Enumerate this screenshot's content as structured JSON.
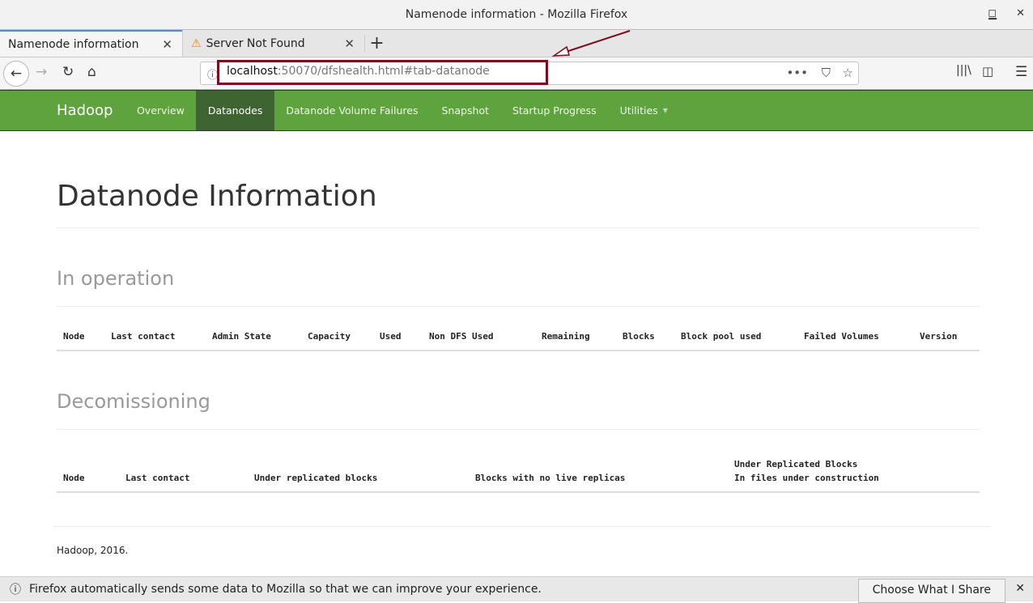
{
  "window": {
    "title": "Namenode information - Mozilla Firefox"
  },
  "tabs": [
    {
      "label": "Namenode information",
      "active": true
    },
    {
      "label": "Server Not Found",
      "icon": "warning-icon"
    }
  ],
  "url": {
    "host": "localhost",
    "rest": ":50070/dfshealth.html#tab-datanode"
  },
  "navbar": {
    "brand": "Hadoop",
    "items": [
      "Overview",
      "Datanodes",
      "Datanode Volume Failures",
      "Snapshot",
      "Startup Progress",
      "Utilities"
    ],
    "active": "Datanodes",
    "color": "#5fa33e"
  },
  "page": {
    "title": "Datanode Information",
    "in_operation": {
      "heading": "In operation",
      "columns": [
        "Node",
        "Last contact",
        "Admin State",
        "Capacity",
        "Used",
        "Non DFS Used",
        "Remaining",
        "Blocks",
        "Block pool used",
        "Failed Volumes",
        "Version"
      ]
    },
    "decommissioning": {
      "heading": "Decomissioning",
      "columns": [
        "Node",
        "Last contact",
        "Under replicated blocks",
        "Blocks with no live replicas",
        "Under Replicated Blocks",
        "In files under construction"
      ]
    },
    "footer": "Hadoop, 2016."
  },
  "notification": {
    "text": "Firefox automatically sends some data to Mozilla so that we can improve your experience.",
    "button": "Choose What I Share"
  }
}
